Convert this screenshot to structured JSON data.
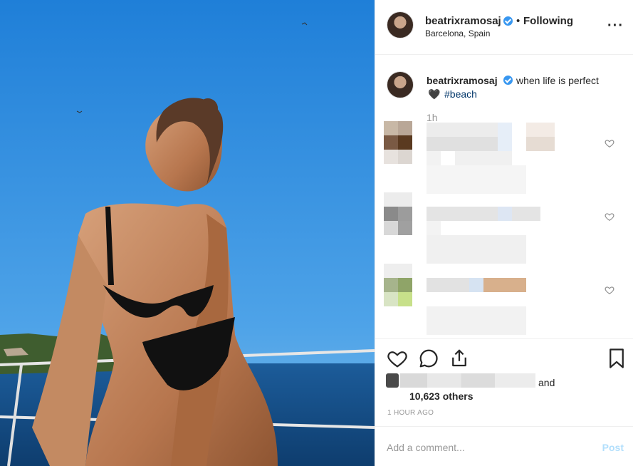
{
  "post": {
    "username": "beatrixramosaj",
    "follow_separator": "•",
    "follow_status": "Following",
    "location": "Barcelona, Spain",
    "more_icon": "more-options-icon",
    "more_glyph": "···"
  },
  "caption": {
    "username": "beatrixramosaj",
    "text": "when life is perfect",
    "emoji": "🖤",
    "hashtag": "#beach",
    "time": "1h"
  },
  "actions": {
    "icons": [
      "heart-icon",
      "comment-icon",
      "share-icon",
      "bookmark-icon"
    ],
    "likes_suffix": "and",
    "others": "10,623 others",
    "posted_ago": "1 HOUR AGO"
  },
  "comment_box": {
    "placeholder": "Add a comment...",
    "post_label": "Post"
  },
  "colors": {
    "link": "#003569",
    "verified": "#3897f0",
    "post_disabled": "#b2dffc",
    "muted": "#999999"
  }
}
